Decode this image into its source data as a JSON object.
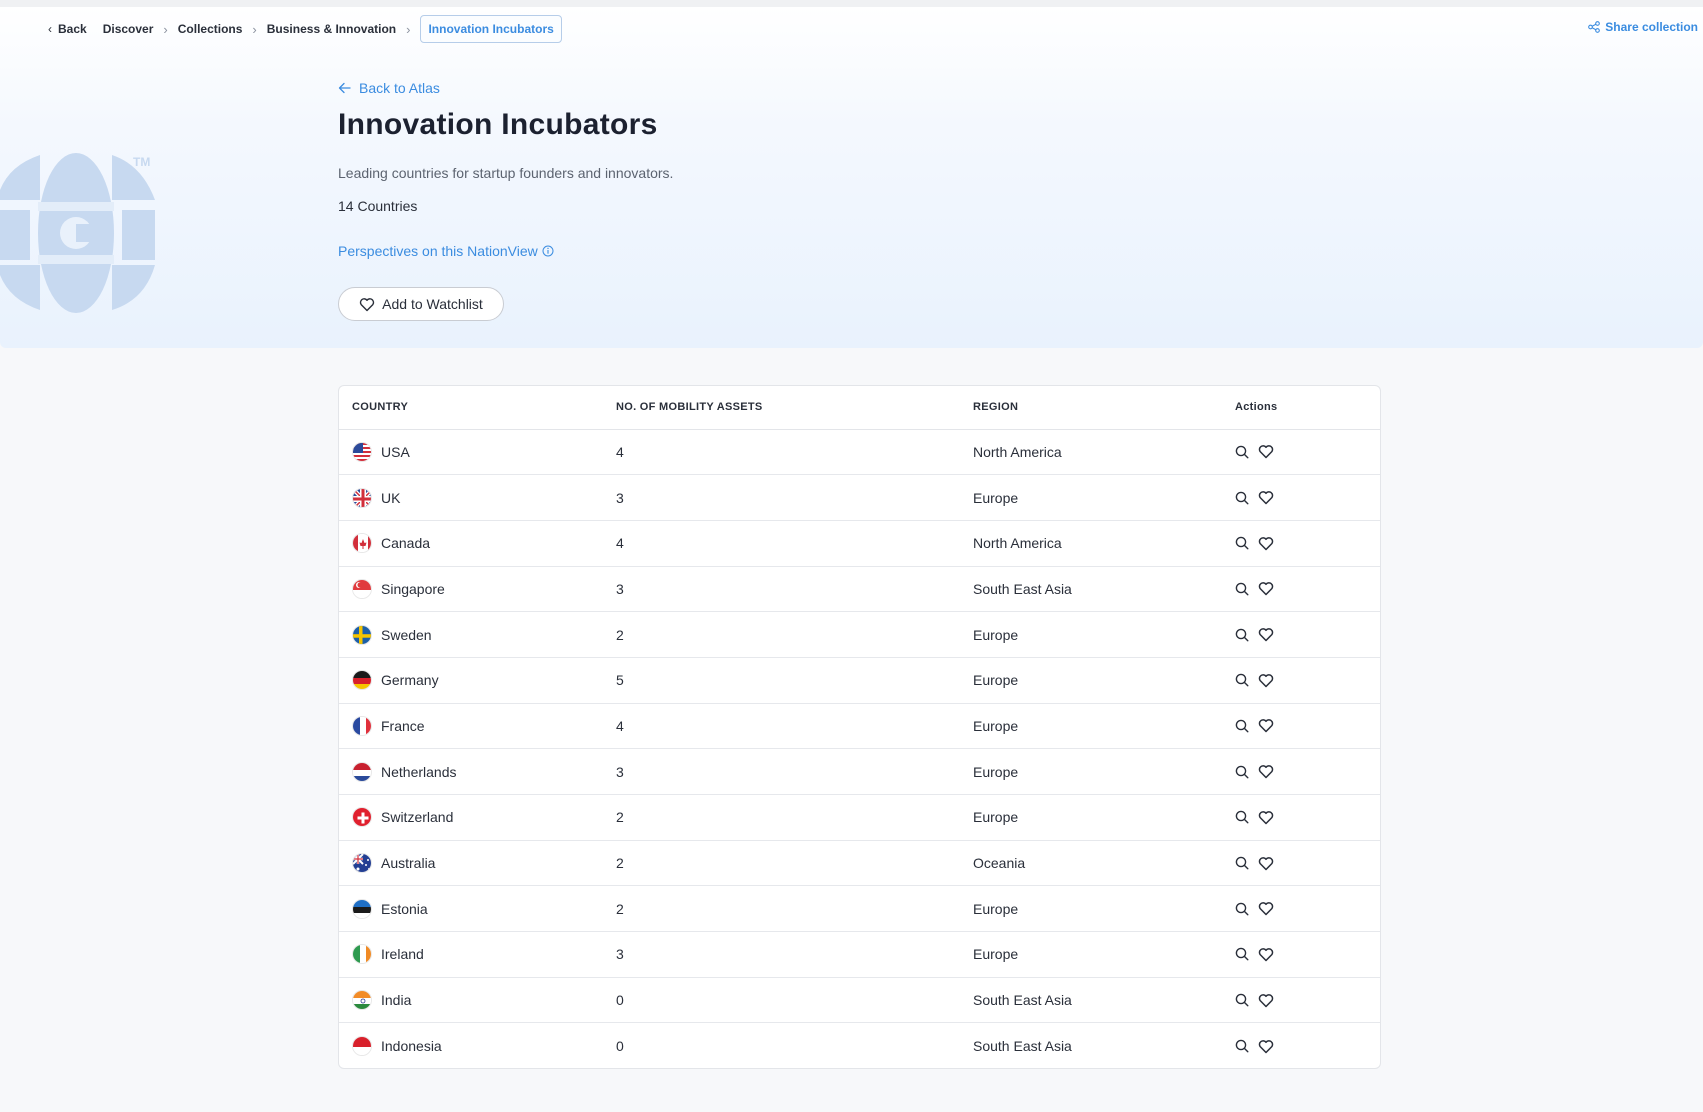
{
  "breadcrumb": {
    "back": "Back",
    "items": [
      "Discover",
      "Collections",
      "Business & Innovation"
    ],
    "current": "Innovation Incubators"
  },
  "share_label": "Share collection",
  "hero": {
    "back_link": "Back to Atlas",
    "title": "Innovation Incubators",
    "subtitle": "Leading countries for startup founders and innovators.",
    "count": "14 Countries",
    "perspectives": "Perspectives on this NationView",
    "watchlist_button": "Add to Watchlist"
  },
  "table": {
    "headers": {
      "country": "COUNTRY",
      "assets": "NO. OF MOBILITY ASSETS",
      "region": "REGION",
      "actions": "Actions"
    },
    "rows": [
      {
        "country": "USA",
        "flag": "us",
        "assets": "4",
        "region": "North America"
      },
      {
        "country": "UK",
        "flag": "uk",
        "assets": "3",
        "region": "Europe"
      },
      {
        "country": "Canada",
        "flag": "ca",
        "assets": "4",
        "region": "North America"
      },
      {
        "country": "Singapore",
        "flag": "sg",
        "assets": "3",
        "region": "South East Asia"
      },
      {
        "country": "Sweden",
        "flag": "se",
        "assets": "2",
        "region": "Europe"
      },
      {
        "country": "Germany",
        "flag": "de",
        "assets": "5",
        "region": "Europe"
      },
      {
        "country": "France",
        "flag": "fr",
        "assets": "4",
        "region": "Europe"
      },
      {
        "country": "Netherlands",
        "flag": "nl",
        "assets": "3",
        "region": "Europe"
      },
      {
        "country": "Switzerland",
        "flag": "ch",
        "assets": "2",
        "region": "Europe"
      },
      {
        "country": "Australia",
        "flag": "au",
        "assets": "2",
        "region": "Oceania"
      },
      {
        "country": "Estonia",
        "flag": "ee",
        "assets": "2",
        "region": "Europe"
      },
      {
        "country": "Ireland",
        "flag": "ie",
        "assets": "3",
        "region": "Europe"
      },
      {
        "country": "India",
        "flag": "in",
        "assets": "0",
        "region": "South East Asia"
      },
      {
        "country": "Indonesia",
        "flag": "id",
        "assets": "0",
        "region": "South East Asia"
      }
    ]
  },
  "colors": {
    "accent": "#3b8ce0",
    "text": "#2a2f3a",
    "logo": "#c7d9f0"
  },
  "logo_mark": "TM"
}
